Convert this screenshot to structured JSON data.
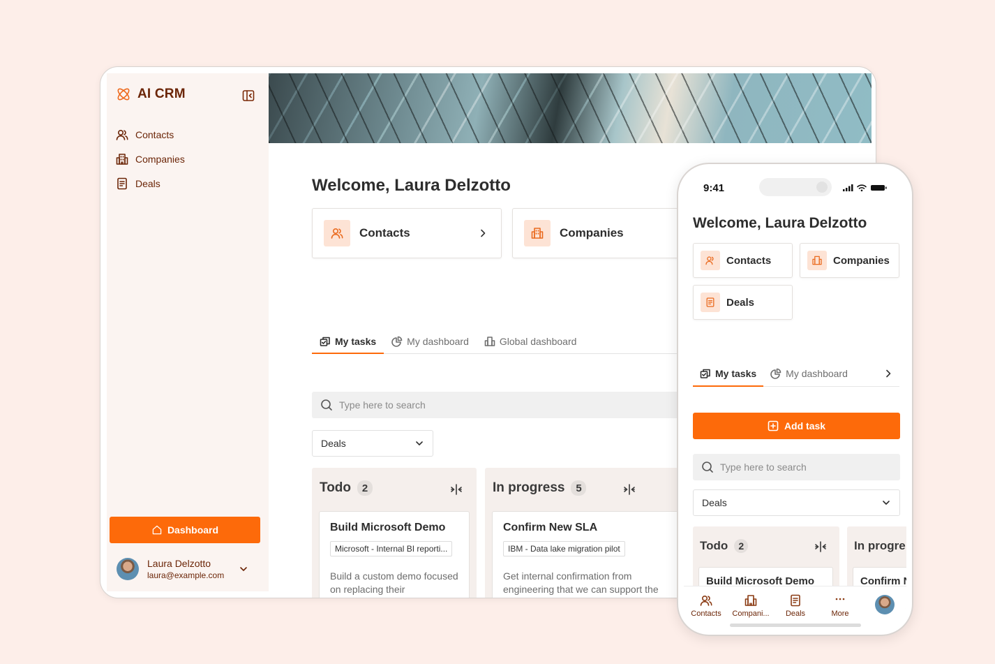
{
  "brand": {
    "name": "AI CRM",
    "accent": "#fd6a0a",
    "text_color": "#6b2507"
  },
  "sidebar": {
    "items": [
      {
        "label": "Contacts",
        "icon": "users-icon"
      },
      {
        "label": "Companies",
        "icon": "building-icon"
      },
      {
        "label": "Deals",
        "icon": "document-icon"
      }
    ],
    "dashboard_button": "Dashboard",
    "user": {
      "name": "Laura Delzotto",
      "email": "laura@example.com"
    }
  },
  "main": {
    "welcome": "Welcome, Laura Delzotto",
    "quick_cards": [
      {
        "label": "Contacts",
        "icon": "users-icon"
      },
      {
        "label": "Companies",
        "icon": "building-icon"
      }
    ],
    "tabs": [
      {
        "label": "My tasks",
        "active": true
      },
      {
        "label": "My dashboard",
        "active": false
      },
      {
        "label": "Global dashboard",
        "active": false
      }
    ],
    "search_placeholder": "Type here to search",
    "filter_value": "Deals",
    "columns": [
      {
        "title": "Todo",
        "count": "2",
        "task": {
          "title": "Build Microsoft Demo",
          "tag": "Microsoft - Internal BI reporti...",
          "description": "Build a custom demo focused on replacing their"
        }
      },
      {
        "title": "In progress",
        "count": "5",
        "task": {
          "title": "Confirm New SLA",
          "tag": "IBM - Data lake migration pilot",
          "description": "Get internal confirmation from engineering that we can support the"
        }
      }
    ]
  },
  "phone": {
    "time": "9:41",
    "welcome": "Welcome, Laura Delzotto",
    "quick_cards": [
      {
        "label": "Contacts",
        "icon": "users-icon"
      },
      {
        "label": "Companies",
        "icon": "building-icon"
      },
      {
        "label": "Deals",
        "icon": "document-icon"
      }
    ],
    "tabs": [
      {
        "label": "My tasks",
        "active": true
      },
      {
        "label": "My dashboard",
        "active": false
      }
    ],
    "add_task": "Add task",
    "search_placeholder": "Type here to search",
    "filter_value": "Deals",
    "columns": [
      {
        "title": "Todo",
        "count": "2",
        "task_title": "Build Microsoft Demo"
      },
      {
        "title": "In progre",
        "task_title": "Confirm N"
      }
    ],
    "bottom_nav": [
      {
        "label": "Contacts",
        "icon": "users-icon"
      },
      {
        "label": "Compani...",
        "icon": "building-icon"
      },
      {
        "label": "Deals",
        "icon": "document-icon"
      },
      {
        "label": "More",
        "icon": "more-icon"
      }
    ]
  }
}
